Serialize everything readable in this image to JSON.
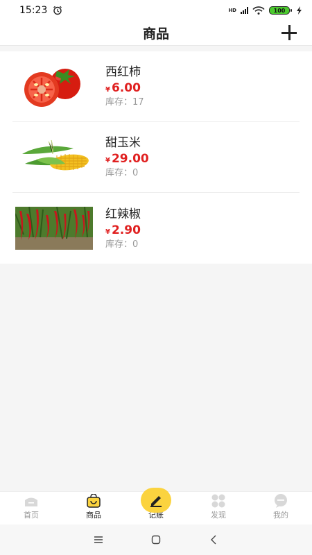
{
  "status_bar": {
    "time": "15:23",
    "network": "HD",
    "battery": "100"
  },
  "header": {
    "title": "商品"
  },
  "products": [
    {
      "name": "西红柿",
      "currency": "¥",
      "price": "6.00",
      "stock": "库存：17",
      "image_icon": "tomato-image"
    },
    {
      "name": "甜玉米",
      "currency": "¥",
      "price": "29.00",
      "stock": "库存：0",
      "image_icon": "corn-image"
    },
    {
      "name": "红辣椒",
      "currency": "¥",
      "price": "2.90",
      "stock": "库存：0",
      "image_icon": "chili-image"
    }
  ],
  "tabbar": {
    "items": [
      {
        "label": "首页",
        "icon": "home-icon"
      },
      {
        "label": "商品",
        "icon": "shopping-bag-icon"
      },
      {
        "label": "记账",
        "icon": "pen-icon"
      },
      {
        "label": "发现",
        "icon": "grid-icon"
      },
      {
        "label": "我的",
        "icon": "chat-icon"
      }
    ]
  },
  "colors": {
    "price": "#e02020",
    "accent": "#fbd33f",
    "battery": "#4ccb2f"
  }
}
